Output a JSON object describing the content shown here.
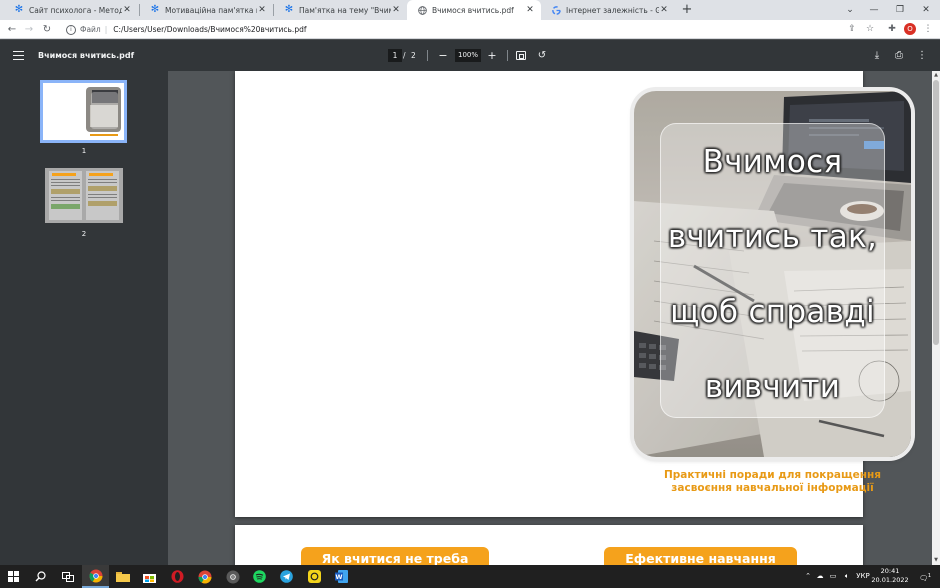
{
  "browser": {
    "tabs": [
      {
        "title": "Сайт психолога - Методичні ма",
        "icon": "snowflake-icon"
      },
      {
        "title": "Мотиваційна пам'ятка на тему",
        "icon": "snowflake-icon"
      },
      {
        "title": "Пам'ятка на тему \"Вчимося вчи",
        "icon": "snowflake-icon"
      },
      {
        "title": "Вчимося вчитись.pdf",
        "icon": "globe-icon",
        "active": true
      },
      {
        "title": "Інтернет залежність - Google П",
        "icon": "google-icon"
      }
    ],
    "address": {
      "scheme": "Файл",
      "url": "C:/Users/User/Downloads/Вчимося%20вчитись.pdf"
    },
    "profile_initial": "O"
  },
  "pdf_toolbar": {
    "title": "Вчимося вчитись.pdf",
    "current_page": "1",
    "separator": "/",
    "total_pages": "2",
    "zoom": "100%"
  },
  "sidebar": {
    "thumbnails": [
      {
        "label": "1"
      },
      {
        "label": "2"
      }
    ]
  },
  "document": {
    "headline_lines": [
      "Вчимося",
      "вчитись так,",
      "щоб справді",
      "вивчити"
    ],
    "subtitle_lines": [
      "Практичні поради для покращення",
      "засвоєння навчальної інформації"
    ],
    "page2_buttons": [
      "Як вчитися не треба",
      "Ефективне навчання"
    ],
    "accent_color": "#f5a21c"
  },
  "taskbar": {
    "language": "УКР",
    "time": "20:41",
    "date": "20.01.2022",
    "notification_count": "1"
  }
}
